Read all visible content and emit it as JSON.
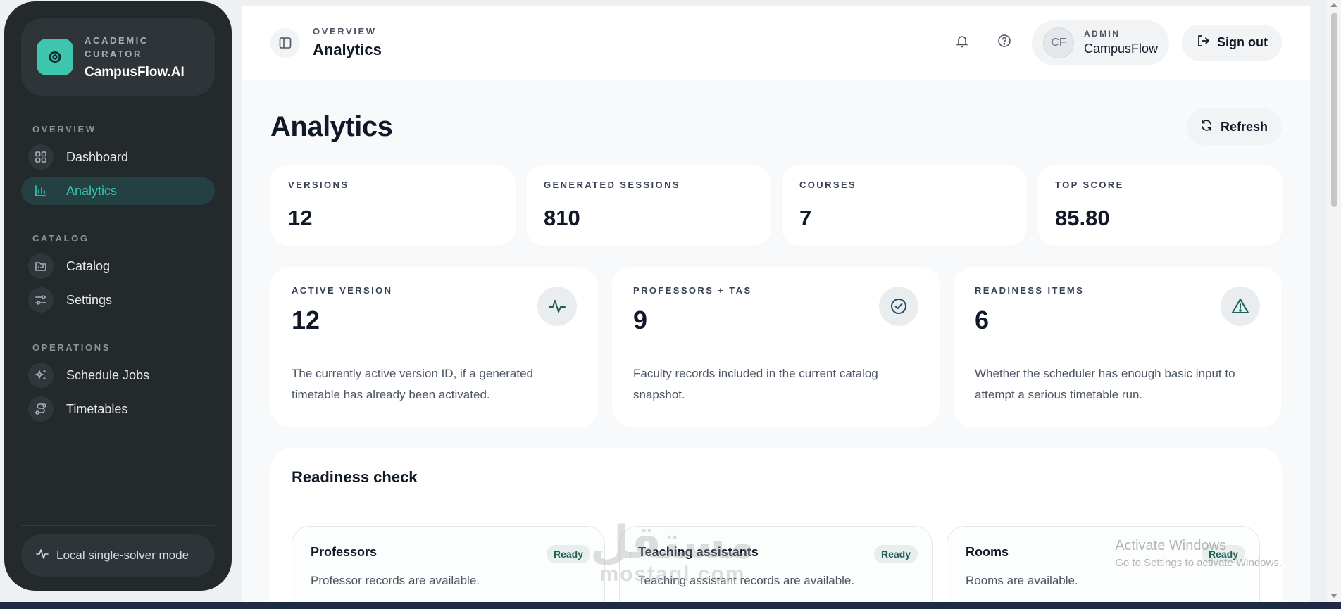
{
  "sidebar": {
    "brand_sub": "ACADEMIC CURATOR",
    "brand_name": "CampusFlow.AI",
    "sections": [
      {
        "heading": "OVERVIEW",
        "items": [
          {
            "label": "Dashboard",
            "icon": "grid-icon"
          },
          {
            "label": "Analytics",
            "icon": "bar-chart-icon",
            "active": true
          }
        ]
      },
      {
        "heading": "CATALOG",
        "items": [
          {
            "label": "Catalog",
            "icon": "catalog-icon"
          },
          {
            "label": "Settings",
            "icon": "sliders-icon"
          }
        ]
      },
      {
        "heading": "OPERATIONS",
        "items": [
          {
            "label": "Schedule Jobs",
            "icon": "sparkle-icon"
          },
          {
            "label": "Timetables",
            "icon": "route-icon"
          }
        ]
      }
    ],
    "footer": "Local single-solver mode"
  },
  "topbar": {
    "crumb_small": "OVERVIEW",
    "crumb_big": "Analytics",
    "avatar": "CF",
    "user_role": "ADMIN",
    "user_name": "CampusFlow",
    "signout": "Sign out"
  },
  "page": {
    "title": "Analytics",
    "refresh": "Refresh"
  },
  "stats": [
    {
      "label": "VERSIONS",
      "value": "12"
    },
    {
      "label": "GENERATED SESSIONS",
      "value": "810"
    },
    {
      "label": "COURSES",
      "value": "7"
    },
    {
      "label": "TOP SCORE",
      "value": "85.80"
    }
  ],
  "kpis": [
    {
      "label": "ACTIVE VERSION",
      "value": "12",
      "desc": "The currently active version ID, if a generated timetable has already been activated.",
      "icon": "activity-icon"
    },
    {
      "label": "PROFESSORS + TAS",
      "value": "9",
      "desc": "Faculty records included in the current catalog snapshot.",
      "icon": "check-circle-icon"
    },
    {
      "label": "READINESS ITEMS",
      "value": "6",
      "desc": "Whether the scheduler has enough basic input to attempt a serious timetable run.",
      "icon": "warning-icon"
    }
  ],
  "readiness": {
    "title": "Readiness check",
    "checks": [
      {
        "name": "Professors",
        "desc": "Professor records are available.",
        "badge": "Ready"
      },
      {
        "name": "Teaching assistants",
        "desc": "Teaching assistant records are available.",
        "badge": "Ready"
      },
      {
        "name": "Rooms",
        "desc": "Rooms are available.",
        "badge": "Ready"
      }
    ]
  },
  "overlay": {
    "activate_title": "Activate Windows",
    "activate_sub": "Go to Settings to activate Windows.",
    "mostaql_ar": "مستقل",
    "mostaql_en": "mostaql.com"
  },
  "colors": {
    "accent": "#37c6b1",
    "sidebar_bg": "#24292c",
    "brand_logo": "#3ec6ae"
  }
}
